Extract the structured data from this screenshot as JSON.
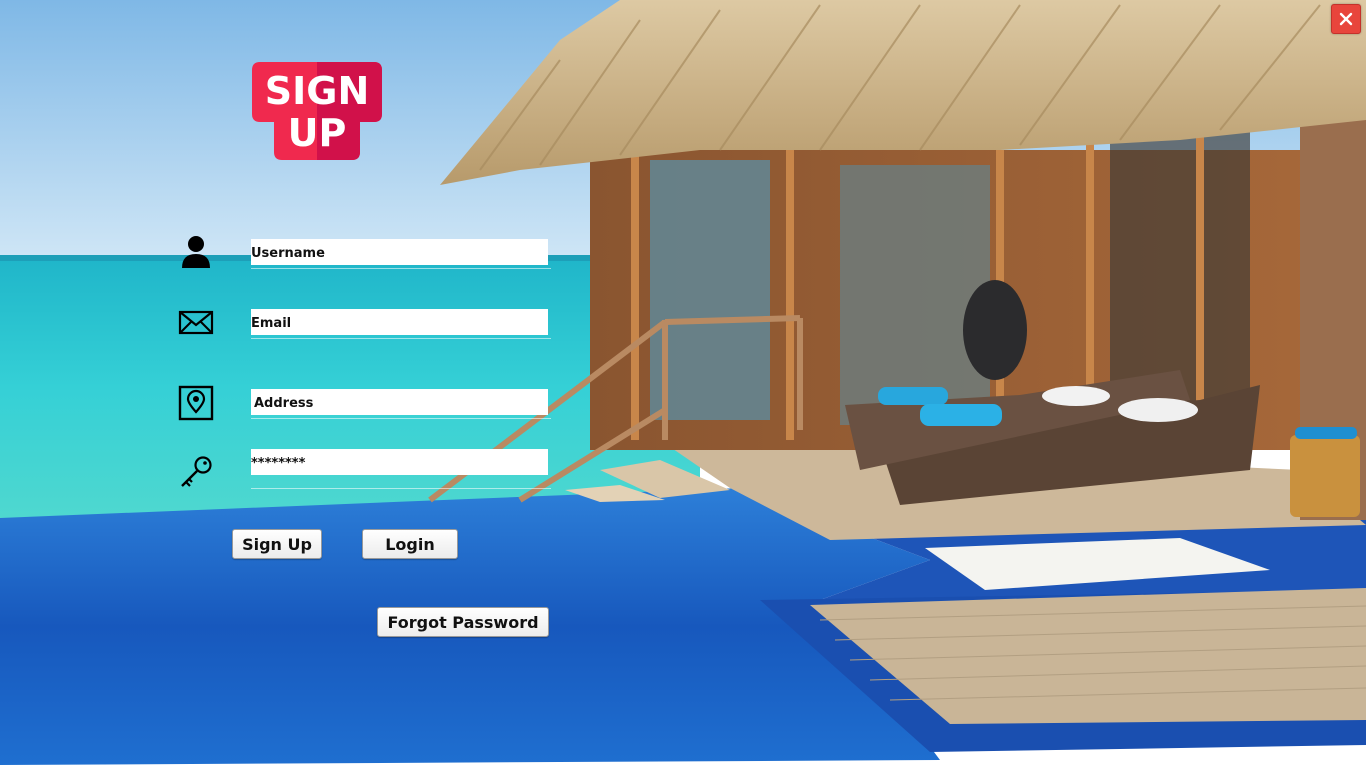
{
  "window": {
    "close_label": "✕"
  },
  "logo": {
    "line1": "SIGN",
    "line2": "UP",
    "color_left": "#f0294e",
    "color_right": "#d1114a"
  },
  "form": {
    "username": {
      "placeholder": "Username",
      "icon": "user-icon"
    },
    "email": {
      "placeholder": "Email",
      "icon": "envelope-icon"
    },
    "address": {
      "placeholder": "Address",
      "icon": "location-pin-icon"
    },
    "password": {
      "value": "********",
      "icon": "key-icon"
    }
  },
  "buttons": {
    "sign_up": "Sign Up",
    "login": "Login",
    "forgot_password": "Forgot Password"
  }
}
